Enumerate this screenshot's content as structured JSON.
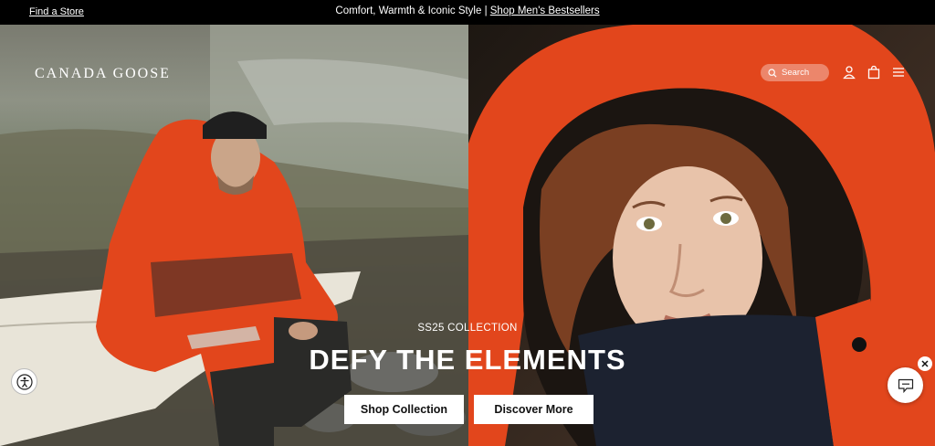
{
  "topbar": {
    "find_store": "Find a Store",
    "promo_text": "Comfort, Warmth & Iconic Style | ",
    "promo_link": "Shop Men's Bestsellers"
  },
  "header": {
    "logo": "CANADA GOOSE",
    "search_placeholder": "Search",
    "icons": [
      "search-icon",
      "account-icon",
      "bag-icon",
      "menu-icon"
    ]
  },
  "hero": {
    "eyebrow": "SS25 COLLECTION",
    "headline": "DEFY THE ELEMENTS",
    "cta_primary": "Shop Collection",
    "cta_secondary": "Discover More"
  },
  "colors": {
    "jacket_orange": "#e2461c",
    "topbar": "#000000",
    "button_bg": "#ffffff"
  }
}
